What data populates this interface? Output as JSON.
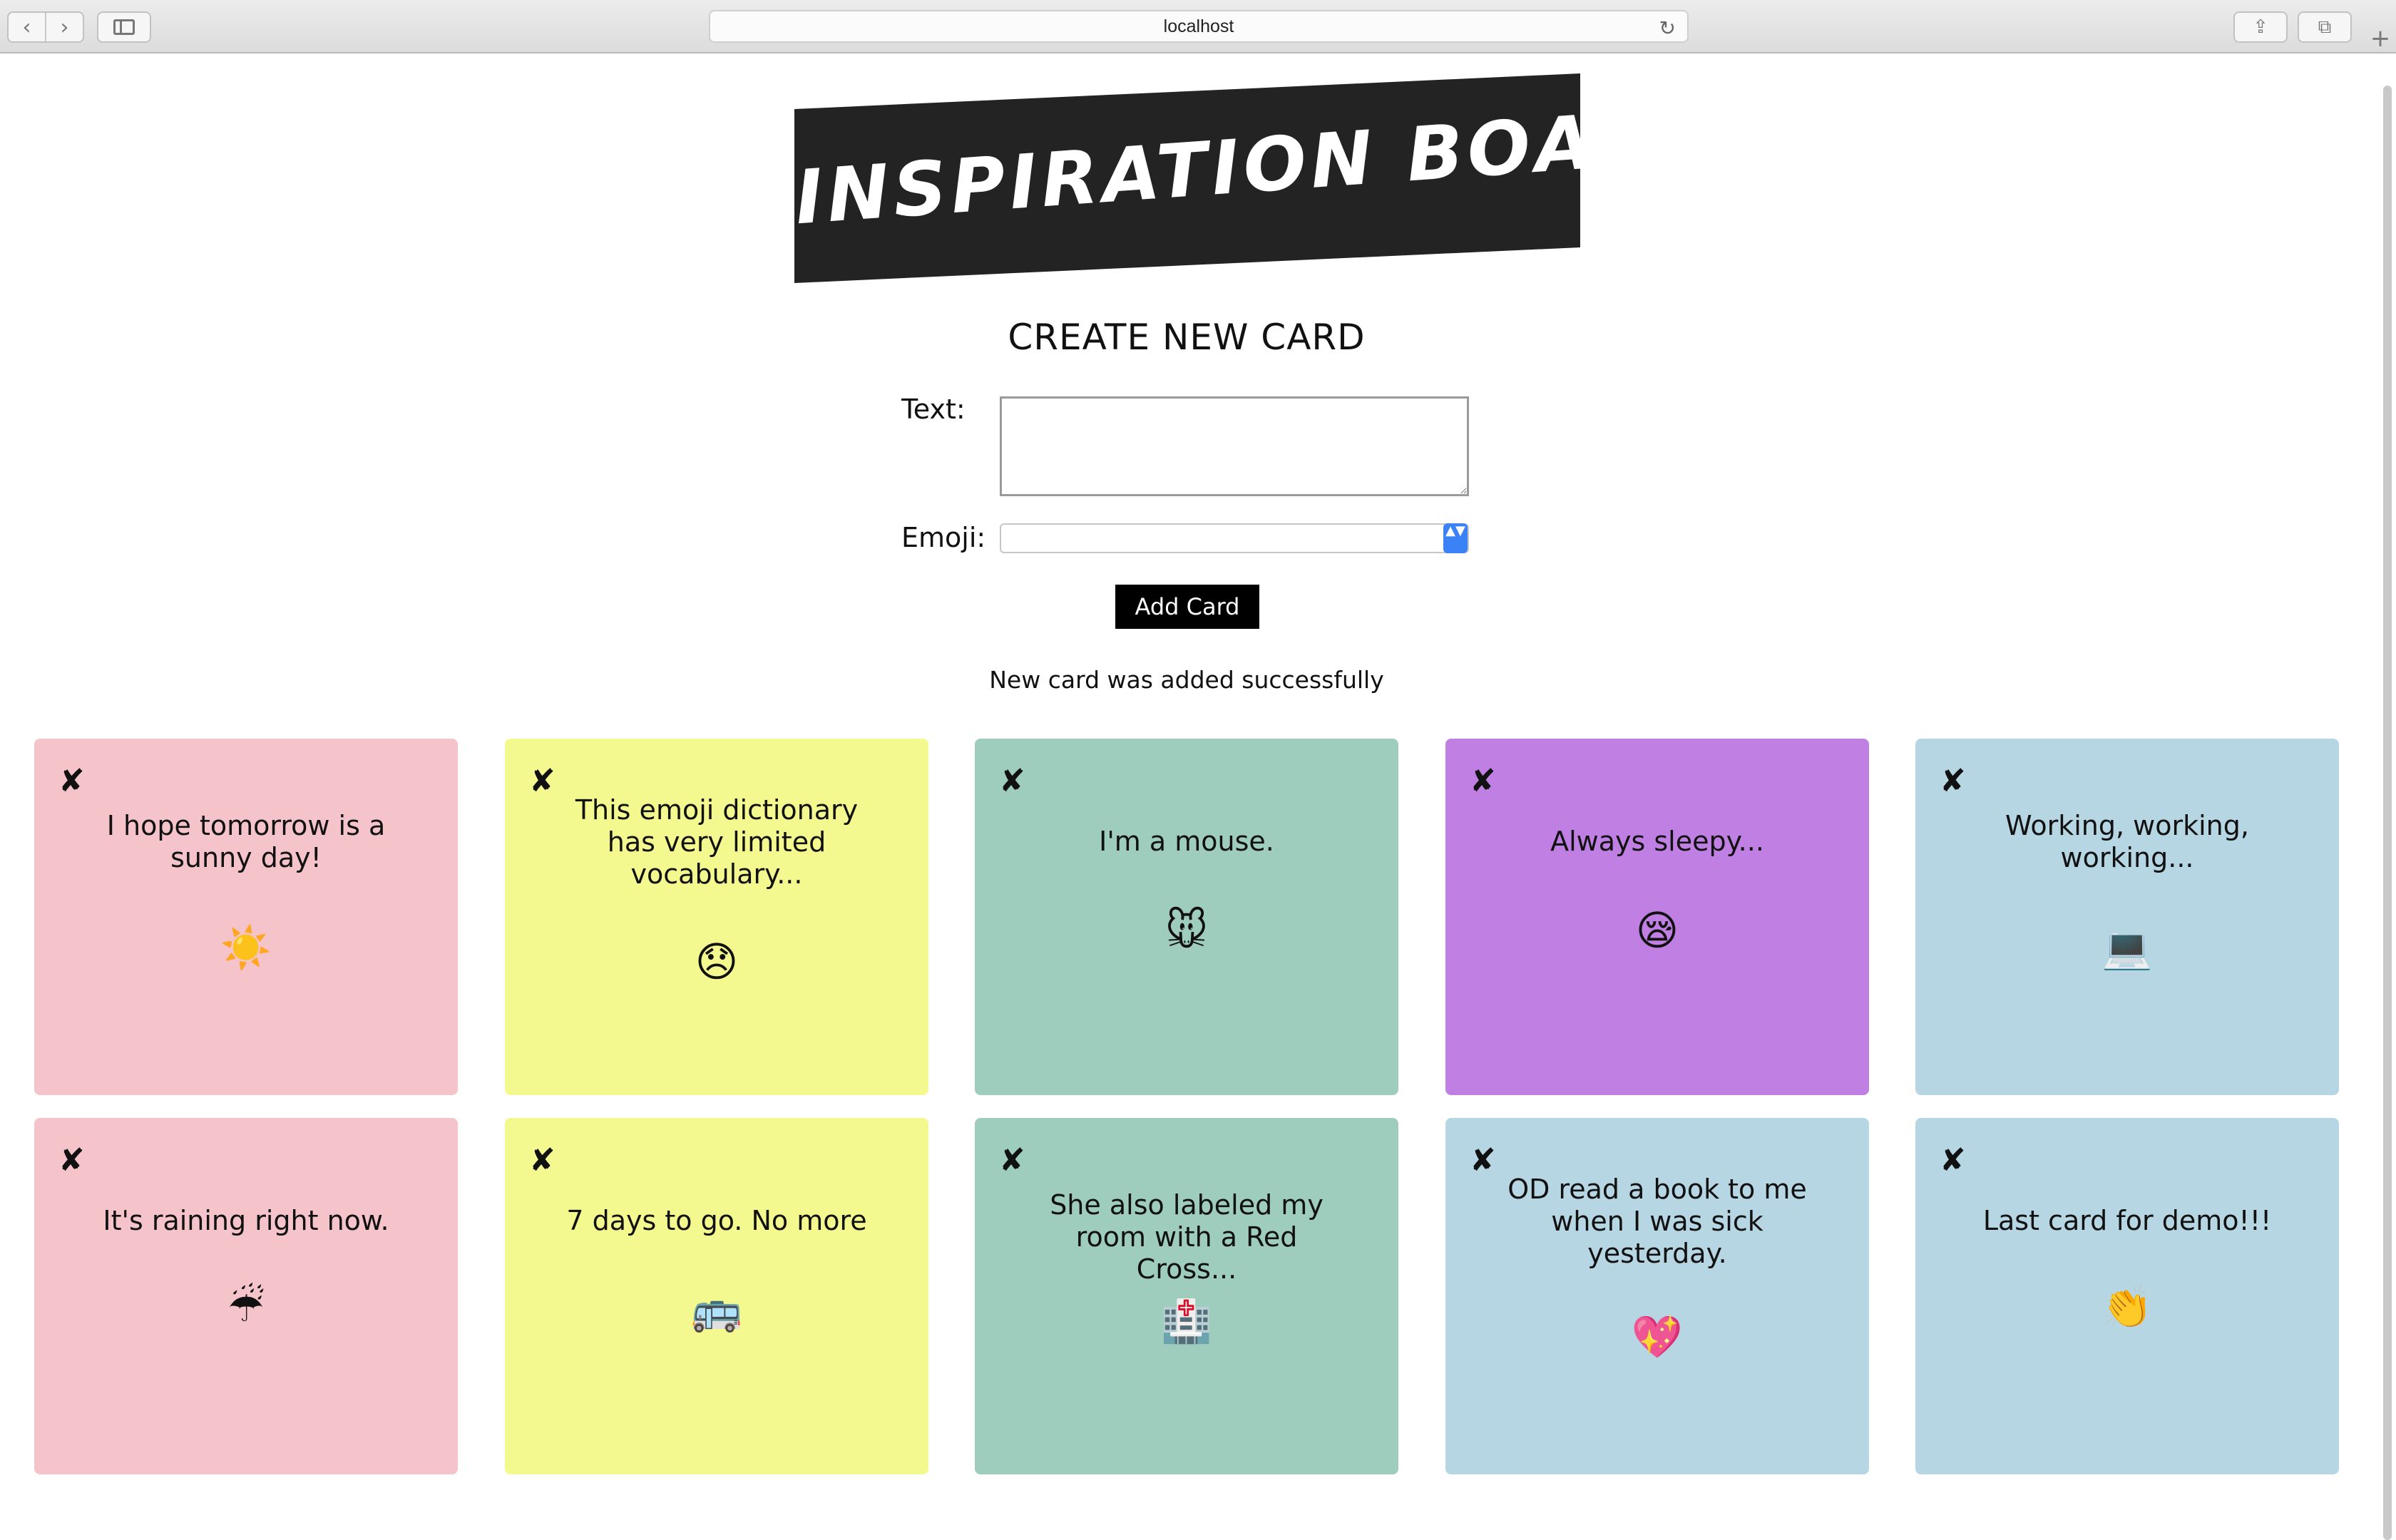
{
  "browser": {
    "url": "localhost",
    "back_icon": "‹",
    "forward_icon": "›",
    "reload_icon": "↻",
    "share_icon": "⇪",
    "tabs_icon": "⧉",
    "new_tab_icon": "+"
  },
  "header": {
    "title": "INSPIRATION BOARD"
  },
  "form": {
    "title": "CREATE NEW CARD",
    "text_label": "Text:",
    "text_value": "",
    "emoji_label": "Emoji:",
    "emoji_selected": "",
    "select_arrow": "▲▼",
    "submit_label": "Add Card",
    "status": "New card was added successfully"
  },
  "cards": [
    {
      "text": "I hope tomorrow is a sunny day!",
      "emoji": "☀️",
      "color": "#f5c3ca"
    },
    {
      "text": "This emoji dictionary has very limited vocabulary...",
      "emoji": "😞",
      "color": "#f4f98f"
    },
    {
      "text": "I'm a mouse.",
      "emoji": "🐭",
      "color": "#9fcdbd"
    },
    {
      "text": "Always sleepy...",
      "emoji": "😪",
      "color": "#bf7fe3"
    },
    {
      "text": "Working, working, working...",
      "emoji": "💻",
      "color": "#b6d6e3"
    },
    {
      "text": "It's raining right now.",
      "emoji": "☔",
      "color": "#f5c3ca"
    },
    {
      "text": "7 days to go. No more",
      "emoji": "🚌",
      "color": "#f4f98f"
    },
    {
      "text": "She also labeled my room with a Red Cross...",
      "emoji": "🏥",
      "color": "#9fcdbd"
    },
    {
      "text": "OD read a book to me when I was sick yesterday.",
      "emoji": "💖",
      "color": "#b6d6e3"
    },
    {
      "text": "Last card for demo!!!",
      "emoji": "👏",
      "color": "#b6d6e3"
    }
  ],
  "card_delete_icon": "✘"
}
